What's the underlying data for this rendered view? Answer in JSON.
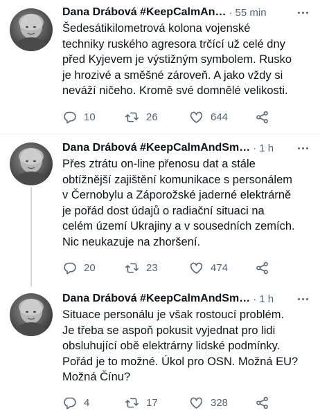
{
  "tweets": [
    {
      "author": "Dana Drábová #KeepCalmAn…",
      "separator": "·",
      "time": "55 min",
      "lines": [
        "Šedesátikilometrová kolona vojenské",
        "techniky ruského agresora trčící už celé dny",
        "před Kyjevem je výstižným symbolem. Rusko",
        "je hrozivé a směšné zároveň. A jako vždy si",
        "neváží ničeho. Kromě své domnělé velikosti."
      ],
      "replies": "10",
      "retweets": "26",
      "likes": "644"
    },
    {
      "author": "Dana Drábová #KeepCalmAndSm…",
      "separator": "·",
      "time": "1 h",
      "lines": [
        "Přes ztrátu on-line přenosu dat a stále",
        "obtížnější zajištění komunikace s personálem",
        "v Černobylu a Záporožské jaderné elektrárně",
        "je pořád dost údajů o radiační situaci na",
        "celém území Ukrajiny a v sousedních zemích.",
        "Nic neukazuje na zhoršení."
      ],
      "replies": "20",
      "retweets": "23",
      "likes": "474"
    },
    {
      "author": "Dana Drábová #KeepCalmAndSm…",
      "separator": "·",
      "time": "1 h",
      "lines": [
        "Situace personálu je však rostoucí problém.",
        "Je třeba se aspoň pokusit vyjednat pro lidi",
        "obsluhující obě elektrárny lidské podmínky.",
        "Pořád je to možné. Úkol pro OSN. Možná EU?",
        "Možná Čínu?"
      ],
      "replies": "4",
      "retweets": "17",
      "likes": "328"
    }
  ],
  "icons": {
    "reply": "reply-icon",
    "retweet": "retweet-icon",
    "like": "heart-icon",
    "share": "share-icon",
    "more": "more-icon"
  },
  "colors": {
    "text": "#0f1419",
    "secondary": "#536471",
    "divider": "#eff3f4",
    "thread_line": "#cfd9de"
  }
}
